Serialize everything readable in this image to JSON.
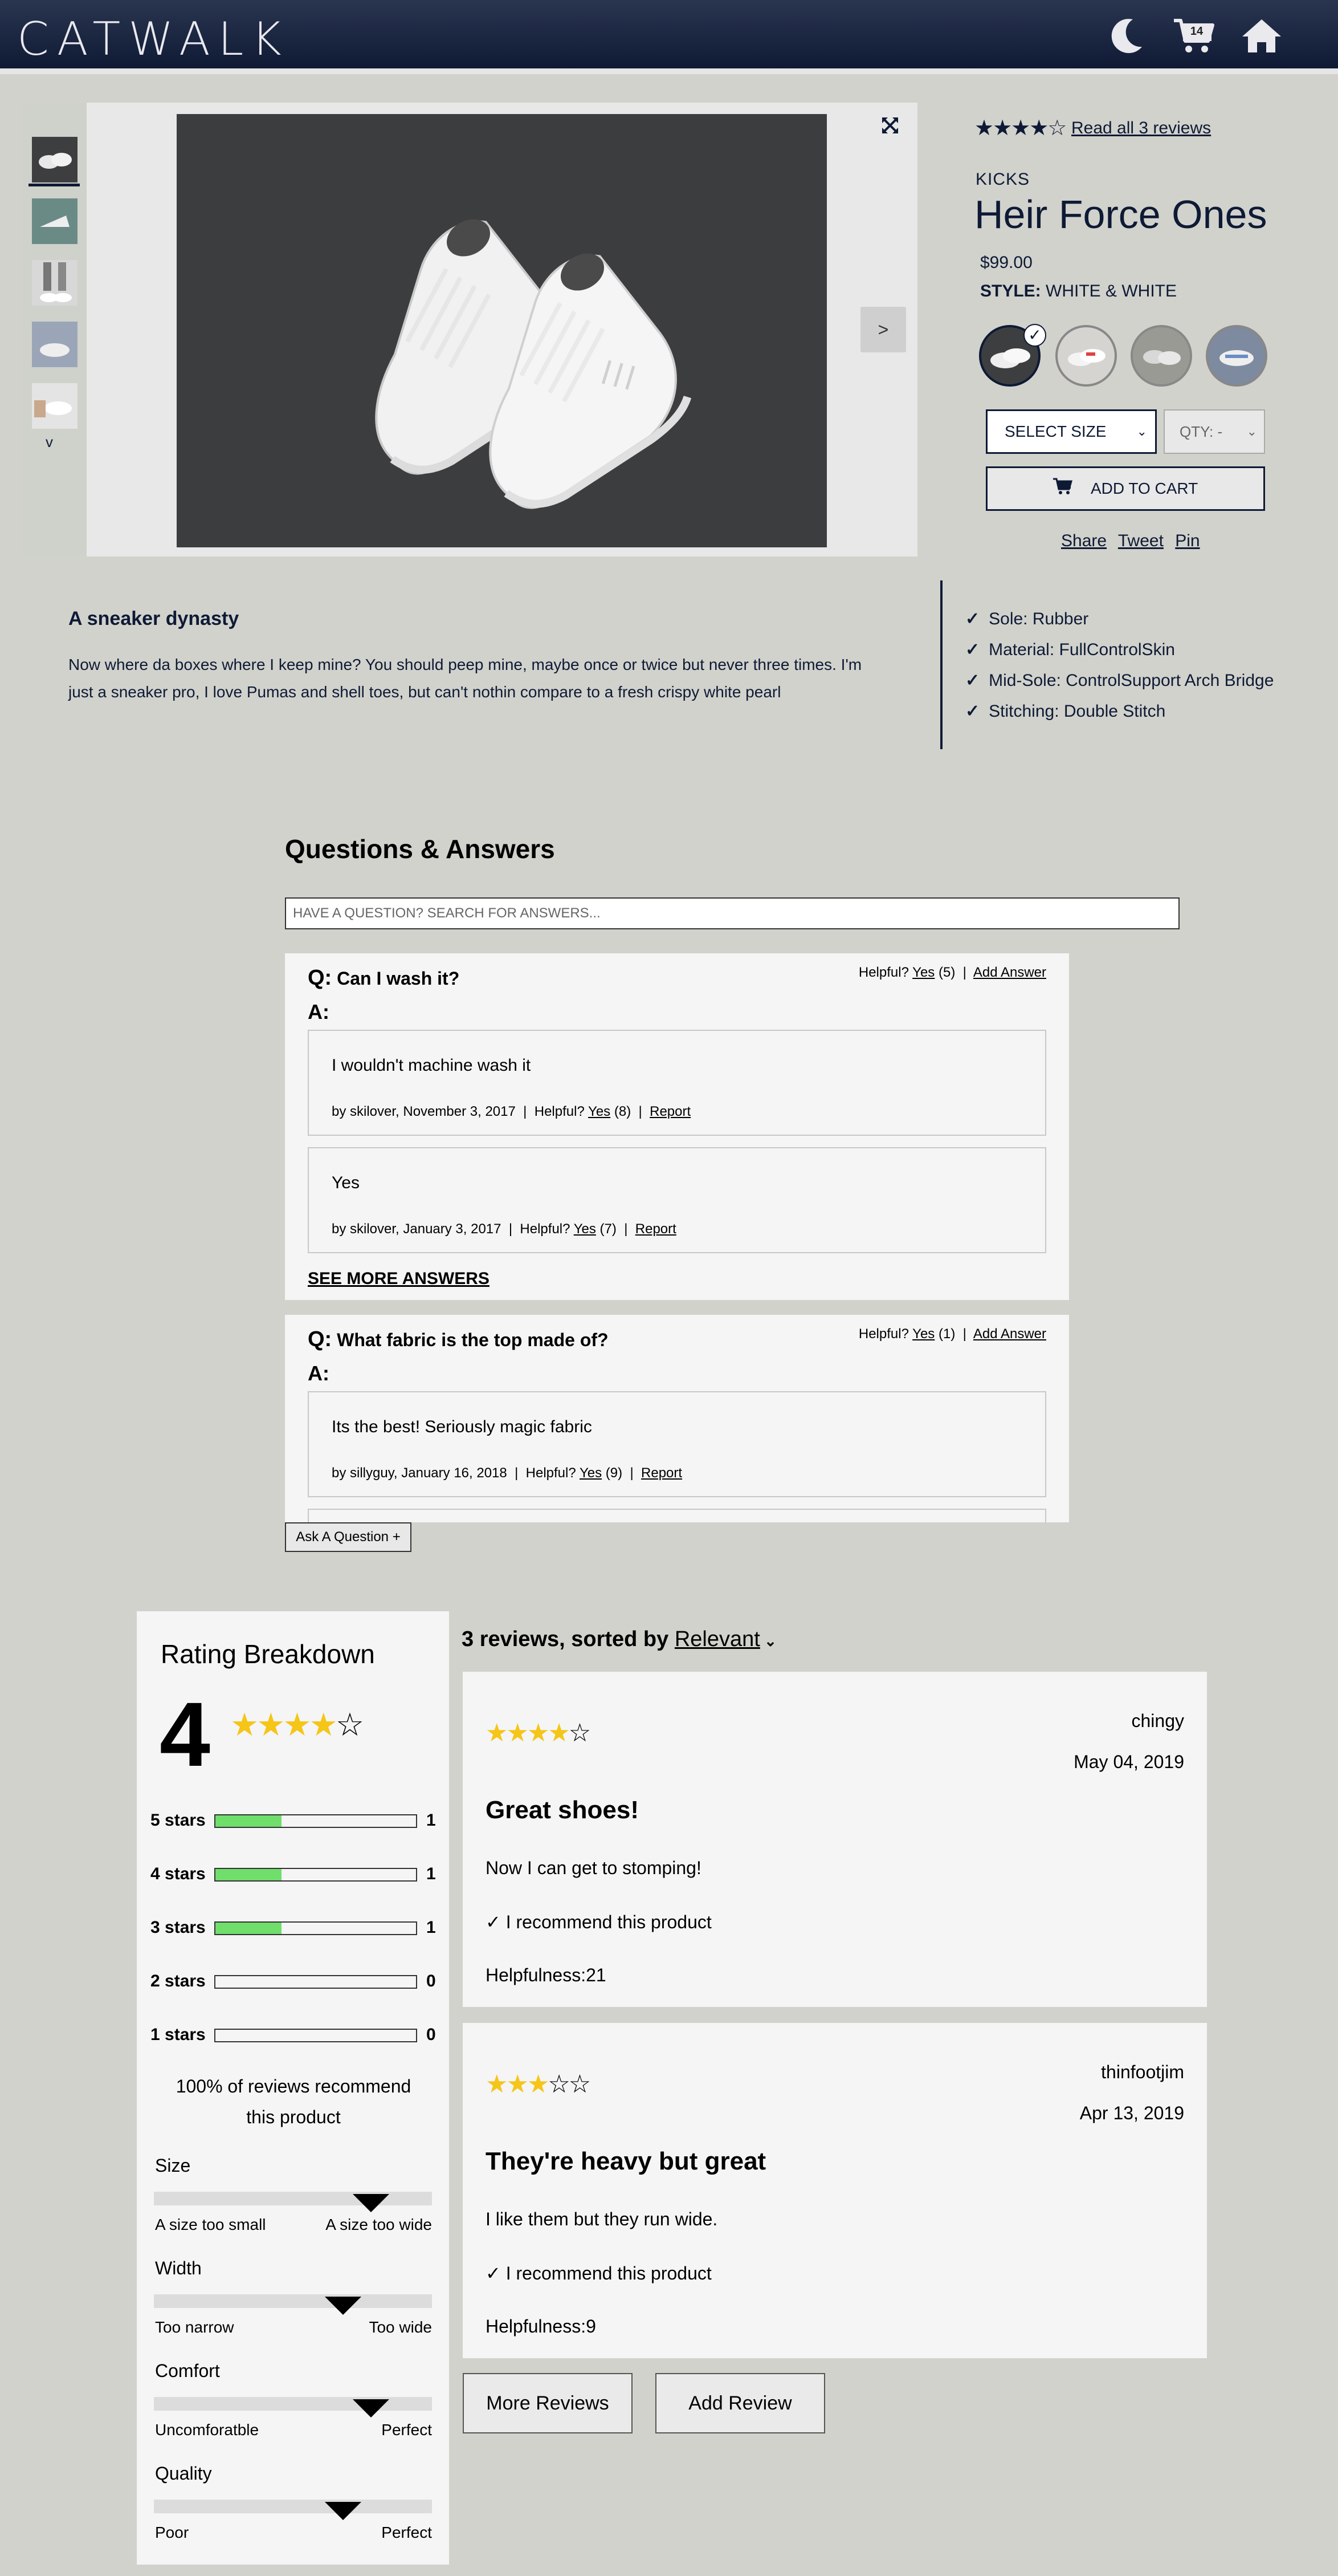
{
  "header": {
    "logo": "CATWALK",
    "cart_count": "14",
    "theme_icon": "moon-icon",
    "cart_icon": "cart-icon",
    "home_icon": "home-icon"
  },
  "gallery": {
    "next_label": ">",
    "down_label": "v",
    "expand_icon": "expand-icon"
  },
  "product": {
    "stars": "★★★★☆",
    "rating_value": 4,
    "read_reviews": "Read all 3 reviews",
    "category": "KICKS",
    "name": "Heir Force Ones",
    "price": "$99.00",
    "style_label": "STYLE:",
    "style_value": "WHITE & WHITE",
    "check": "✓",
    "size_select": "SELECT SIZE",
    "qty_select": "QTY: -",
    "add_to_cart": "ADD TO CART",
    "share": [
      "Share",
      "Tweet",
      "Pin"
    ]
  },
  "description": {
    "title": "A sneaker dynasty",
    "body": "Now where da boxes where I keep mine? You should peep mine, maybe once or twice but never three times. I'm just a sneaker pro, I love Pumas and shell toes, but can't nothin compare to a fresh crispy white pearl",
    "features": [
      "Sole: Rubber",
      "Material: FullControlSkin",
      "Mid-Sole: ControlSupport Arch Bridge",
      "Stitching: Double Stitch"
    ]
  },
  "qa": {
    "title": "Questions & Answers",
    "search_placeholder": "HAVE A QUESTION? SEARCH FOR ANSWERS...",
    "questions": [
      {
        "q_label": "Q:",
        "question": "Can I wash it?",
        "helpful_prefix": "Helpful?",
        "helpful_yes": "Yes",
        "helpful_count": "(5)",
        "add_answer": "Add Answer",
        "a_label": "A:",
        "answers": [
          {
            "text": "I wouldn't machine wash it",
            "meta": "by skilover, November 3, 2017  |  Helpful?",
            "yes": "Yes",
            "count": "(8)",
            "report": "Report"
          },
          {
            "text": "Yes",
            "meta": "by skilover, January 3, 2017  |  Helpful?",
            "yes": "Yes",
            "count": "(7)",
            "report": "Report"
          }
        ],
        "see_more": "SEE MORE ANSWERS"
      },
      {
        "q_label": "Q:",
        "question": "What fabric is the top made of?",
        "helpful_prefix": "Helpful?",
        "helpful_yes": "Yes",
        "helpful_count": "(1)",
        "add_answer": "Add Answer",
        "a_label": "A:",
        "answers": [
          {
            "text": "Its the best! Seriously magic fabric",
            "meta": "by sillyguy, January 16, 2018  |  Helpful?",
            "yes": "Yes",
            "count": "(9)",
            "report": "Report"
          }
        ]
      }
    ],
    "ask_question": "Ask A Question +"
  },
  "ratings": {
    "title": "Rating Breakdown",
    "average": "4",
    "stars": "★★★★☆",
    "rows": [
      {
        "label": "5 stars",
        "count": "1",
        "fraction": 0.33
      },
      {
        "label": "4 stars",
        "count": "1",
        "fraction": 0.33
      },
      {
        "label": "3 stars",
        "count": "1",
        "fraction": 0.33
      },
      {
        "label": "2 stars",
        "count": "0",
        "fraction": 0
      },
      {
        "label": "1 stars",
        "count": "0",
        "fraction": 0
      }
    ],
    "recommend": "100% of reviews recommend this product",
    "characteristics": [
      {
        "name": "Size",
        "low": "A size too small",
        "high": "A size too wide",
        "level": 0.78
      },
      {
        "name": "Width",
        "low": "Too narrow",
        "high": "Too wide",
        "level": 0.68
      },
      {
        "name": "Comfort",
        "low": "Uncomforatble",
        "high": "Perfect",
        "level": 0.78
      },
      {
        "name": "Quality",
        "low": "Poor",
        "high": "Perfect",
        "level": 0.68
      }
    ]
  },
  "reviews": {
    "header_prefix": "3 reviews, sorted by",
    "sort": "Relevant",
    "items": [
      {
        "filled": "★★★★",
        "empty": "☆",
        "rating": 4,
        "user": "chingy",
        "date": "May 04, 2019",
        "summary": "Great shoes!",
        "body": "Now I can get to stomping!",
        "recommend": "✓ I recommend this product",
        "helpfulness": "Helpfulness:21"
      },
      {
        "filled": "★★★",
        "empty": "☆☆",
        "rating": 3,
        "user": "thinfootjim",
        "date": "Apr 13, 2019",
        "summary": "They're heavy but great",
        "body": "I like them but they run wide.",
        "recommend": "✓ I recommend this product",
        "helpfulness": "Helpfulness:9"
      }
    ],
    "more_reviews": "More Reviews",
    "add_review": "Add Review"
  }
}
